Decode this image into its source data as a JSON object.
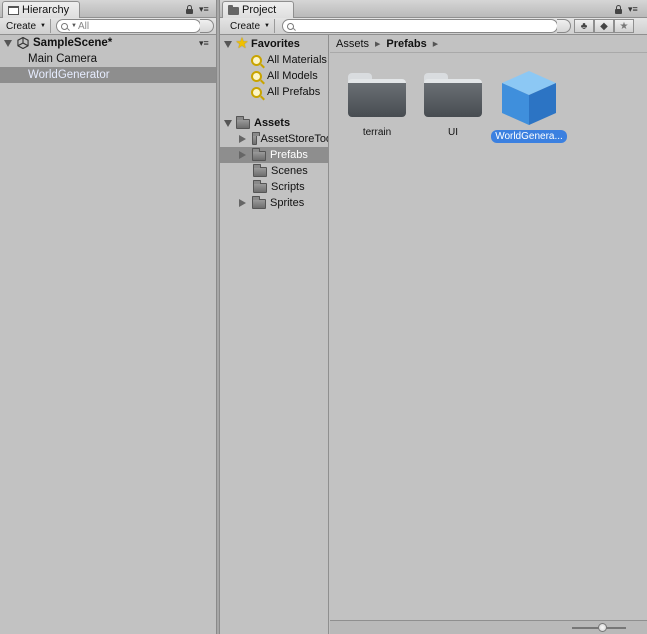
{
  "hierarchy": {
    "tab_label": "Hierarchy",
    "create_label": "Create",
    "search_placeholder": "All",
    "scene": {
      "name": "SampleScene*"
    },
    "objects": [
      {
        "name": "Main Camera",
        "selected": false
      },
      {
        "name": "WorldGenerator",
        "selected": true
      }
    ]
  },
  "project": {
    "tab_label": "Project",
    "create_label": "Create",
    "search_value": "",
    "favorites": {
      "label": "Favorites",
      "items": [
        "All Materials",
        "All Models",
        "All Prefabs"
      ]
    },
    "assets": {
      "label": "Assets",
      "folders": [
        {
          "name": "AssetStoreTools",
          "expandable": true,
          "selected": false
        },
        {
          "name": "Prefabs",
          "expandable": true,
          "selected": true
        },
        {
          "name": "Scenes",
          "expandable": false,
          "selected": false
        },
        {
          "name": "Scripts",
          "expandable": false,
          "selected": false
        },
        {
          "name": "Sprites",
          "expandable": true,
          "selected": false
        }
      ]
    },
    "breadcrumb": [
      "Assets",
      "Prefabs"
    ],
    "contents": [
      {
        "name": "terrain",
        "kind": "folder",
        "selected": false
      },
      {
        "name": "UI",
        "kind": "folder",
        "selected": false
      },
      {
        "name": "WorldGenera...",
        "kind": "prefab",
        "selected": true
      }
    ],
    "zoom_level": 0.58
  },
  "colors": {
    "selection_blue": "#3b80e0",
    "prefab_blue": "#4a9be0",
    "favorites_star": "#f0c000"
  }
}
